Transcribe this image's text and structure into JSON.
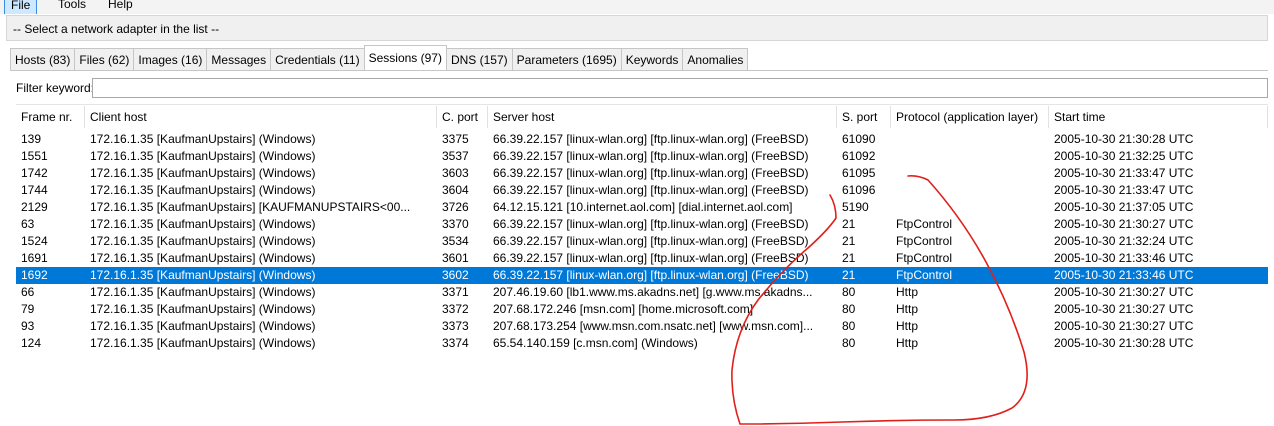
{
  "menu": {
    "items": [
      "File",
      "Tools",
      "Help"
    ]
  },
  "adapter": {
    "text": "-- Select a network adapter in the list --"
  },
  "tabs": [
    "Hosts (83)",
    "Files (62)",
    "Images (16)",
    "Messages",
    "Credentials (11)",
    "Sessions (97)",
    "DNS (157)",
    "Parameters (1695)",
    "Keywords",
    "Anomalies"
  ],
  "selected_tab": "Sessions (97)",
  "filter": {
    "label": "Filter keyword:",
    "value": ""
  },
  "table": {
    "headers": [
      "Frame nr.",
      "Client host",
      "C. port",
      "Server host",
      "S. port",
      "Protocol (application layer)",
      "Start time"
    ],
    "rows": [
      [
        "139",
        "172.16.1.35 [KaufmanUpstairs] (Windows)",
        "3375",
        "66.39.22.157 [linux-wlan.org] [ftp.linux-wlan.org] (FreeBSD)",
        "61090",
        "",
        "2005-10-30 21:30:28 UTC"
      ],
      [
        "1551",
        "172.16.1.35 [KaufmanUpstairs] (Windows)",
        "3537",
        "66.39.22.157 [linux-wlan.org] [ftp.linux-wlan.org] (FreeBSD)",
        "61092",
        "",
        "2005-10-30 21:32:25 UTC"
      ],
      [
        "1742",
        "172.16.1.35 [KaufmanUpstairs] (Windows)",
        "3603",
        "66.39.22.157 [linux-wlan.org] [ftp.linux-wlan.org] (FreeBSD)",
        "61095",
        "",
        "2005-10-30 21:33:47 UTC"
      ],
      [
        "1744",
        "172.16.1.35 [KaufmanUpstairs] (Windows)",
        "3604",
        "66.39.22.157 [linux-wlan.org] [ftp.linux-wlan.org] (FreeBSD)",
        "61096",
        "",
        "2005-10-30 21:33:47 UTC"
      ],
      [
        "2129",
        "172.16.1.35 [KaufmanUpstairs] [KAUFMANUPSTAIRS<00...",
        "3726",
        "64.12.15.121 [10.internet.aol.com] [dial.internet.aol.com]",
        "5190",
        "",
        "2005-10-30 21:37:05 UTC"
      ],
      [
        "63",
        "172.16.1.35 [KaufmanUpstairs] (Windows)",
        "3370",
        "66.39.22.157 [linux-wlan.org] [ftp.linux-wlan.org] (FreeBSD)",
        "21",
        "FtpControl",
        "2005-10-30 21:30:27 UTC"
      ],
      [
        "1524",
        "172.16.1.35 [KaufmanUpstairs] (Windows)",
        "3534",
        "66.39.22.157 [linux-wlan.org] [ftp.linux-wlan.org] (FreeBSD)",
        "21",
        "FtpControl",
        "2005-10-30 21:32:24 UTC"
      ],
      [
        "1691",
        "172.16.1.35 [KaufmanUpstairs] (Windows)",
        "3601",
        "66.39.22.157 [linux-wlan.org] [ftp.linux-wlan.org] (FreeBSD)",
        "21",
        "FtpControl",
        "2005-10-30 21:33:46 UTC"
      ],
      [
        "1692",
        "172.16.1.35 [KaufmanUpstairs] (Windows)",
        "3602",
        "66.39.22.157 [linux-wlan.org] [ftp.linux-wlan.org] (FreeBSD)",
        "21",
        "FtpControl",
        "2005-10-30 21:33:46 UTC"
      ],
      [
        "66",
        "172.16.1.35 [KaufmanUpstairs] (Windows)",
        "3371",
        "207.46.19.60 [lb1.www.ms.akadns.net] [g.www.ms.akadns...",
        "80",
        "Http",
        "2005-10-30 21:30:27 UTC"
      ],
      [
        "79",
        "172.16.1.35 [KaufmanUpstairs] (Windows)",
        "3372",
        "207.68.172.246 [msn.com] [home.microsoft.com]",
        "80",
        "Http",
        "2005-10-30 21:30:27 UTC"
      ],
      [
        "93",
        "172.16.1.35 [KaufmanUpstairs] (Windows)",
        "3373",
        "207.68.173.254 [www.msn.com.nsatc.net] [www.msn.com]...",
        "80",
        "Http",
        "2005-10-30 21:30:27 UTC"
      ],
      [
        "124",
        "172.16.1.35 [KaufmanUpstairs] (Windows)",
        "3374",
        "65.54.140.159 [c.msn.com] (Windows)",
        "80",
        "Http",
        "2005-10-30 21:30:28 UTC"
      ]
    ],
    "selected_row": 8
  },
  "colors": {
    "selection": "#0078d7",
    "annotation": "#e0201b",
    "tab_bg": "#f0f0f0"
  }
}
